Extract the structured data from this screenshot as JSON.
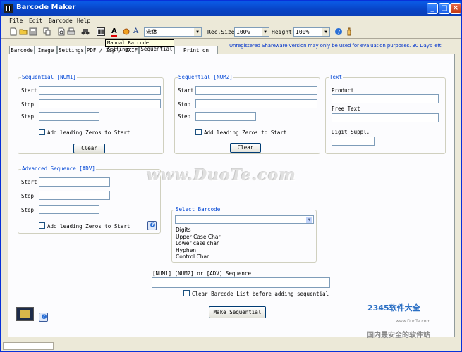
{
  "window": {
    "title": "Barcode Maker"
  },
  "menu": [
    "File",
    "Edit",
    "Barcode",
    "Help"
  ],
  "toolbar": {
    "font_name": "宋体",
    "rec_size_label": "Rec.Size",
    "rec_size_value": "100%",
    "height_label": "Height:",
    "height_value": "100%",
    "tooltip": "Manual Barcode Settings"
  },
  "tabs": [
    "Barcode",
    "Image",
    "Settings",
    "PDF / Zip / EXIF",
    "Sequential",
    "Print on Label"
  ],
  "notice": "Unregistered Shareware version may only be used for evaluation purposes. 30 Days left.",
  "seq1": {
    "title": "Sequential [NUM1]",
    "start": "Start",
    "stop": "Stop",
    "step": "Step",
    "zeros": "Add leading Zeros to Start",
    "clear": "Clear"
  },
  "seq2": {
    "title": "Sequential [NUM2]",
    "start": "Start",
    "stop": "Stop",
    "step": "Step",
    "zeros": "Add leading Zeros to Start",
    "clear": "Clear"
  },
  "text": {
    "title": "Text",
    "product": "Product",
    "free_text": "Free Text",
    "digit": "Digit Suppl."
  },
  "adv": {
    "title": "Advanced Sequence [ADV]",
    "start": "Start",
    "stop": "Stop",
    "step": "Step",
    "zeros": "Add leading Zeros to Start"
  },
  "select_barcode": {
    "title": "Select Barcode",
    "options": [
      "Digits",
      "Upper Case Char",
      "Lower case char",
      "Hyphen",
      "Control Char"
    ]
  },
  "sequence": {
    "label": "[NUM1]  [NUM2] or [ADV] Sequence",
    "clear_list": "Clear Barcode List before adding sequential",
    "make": "Make Sequential"
  },
  "watermark": {
    "main": "www.DuoTe.com",
    "brand": "2345软件大全",
    "url": "www.DuoTe.com",
    "slogan": "国内最安全的软件站"
  }
}
